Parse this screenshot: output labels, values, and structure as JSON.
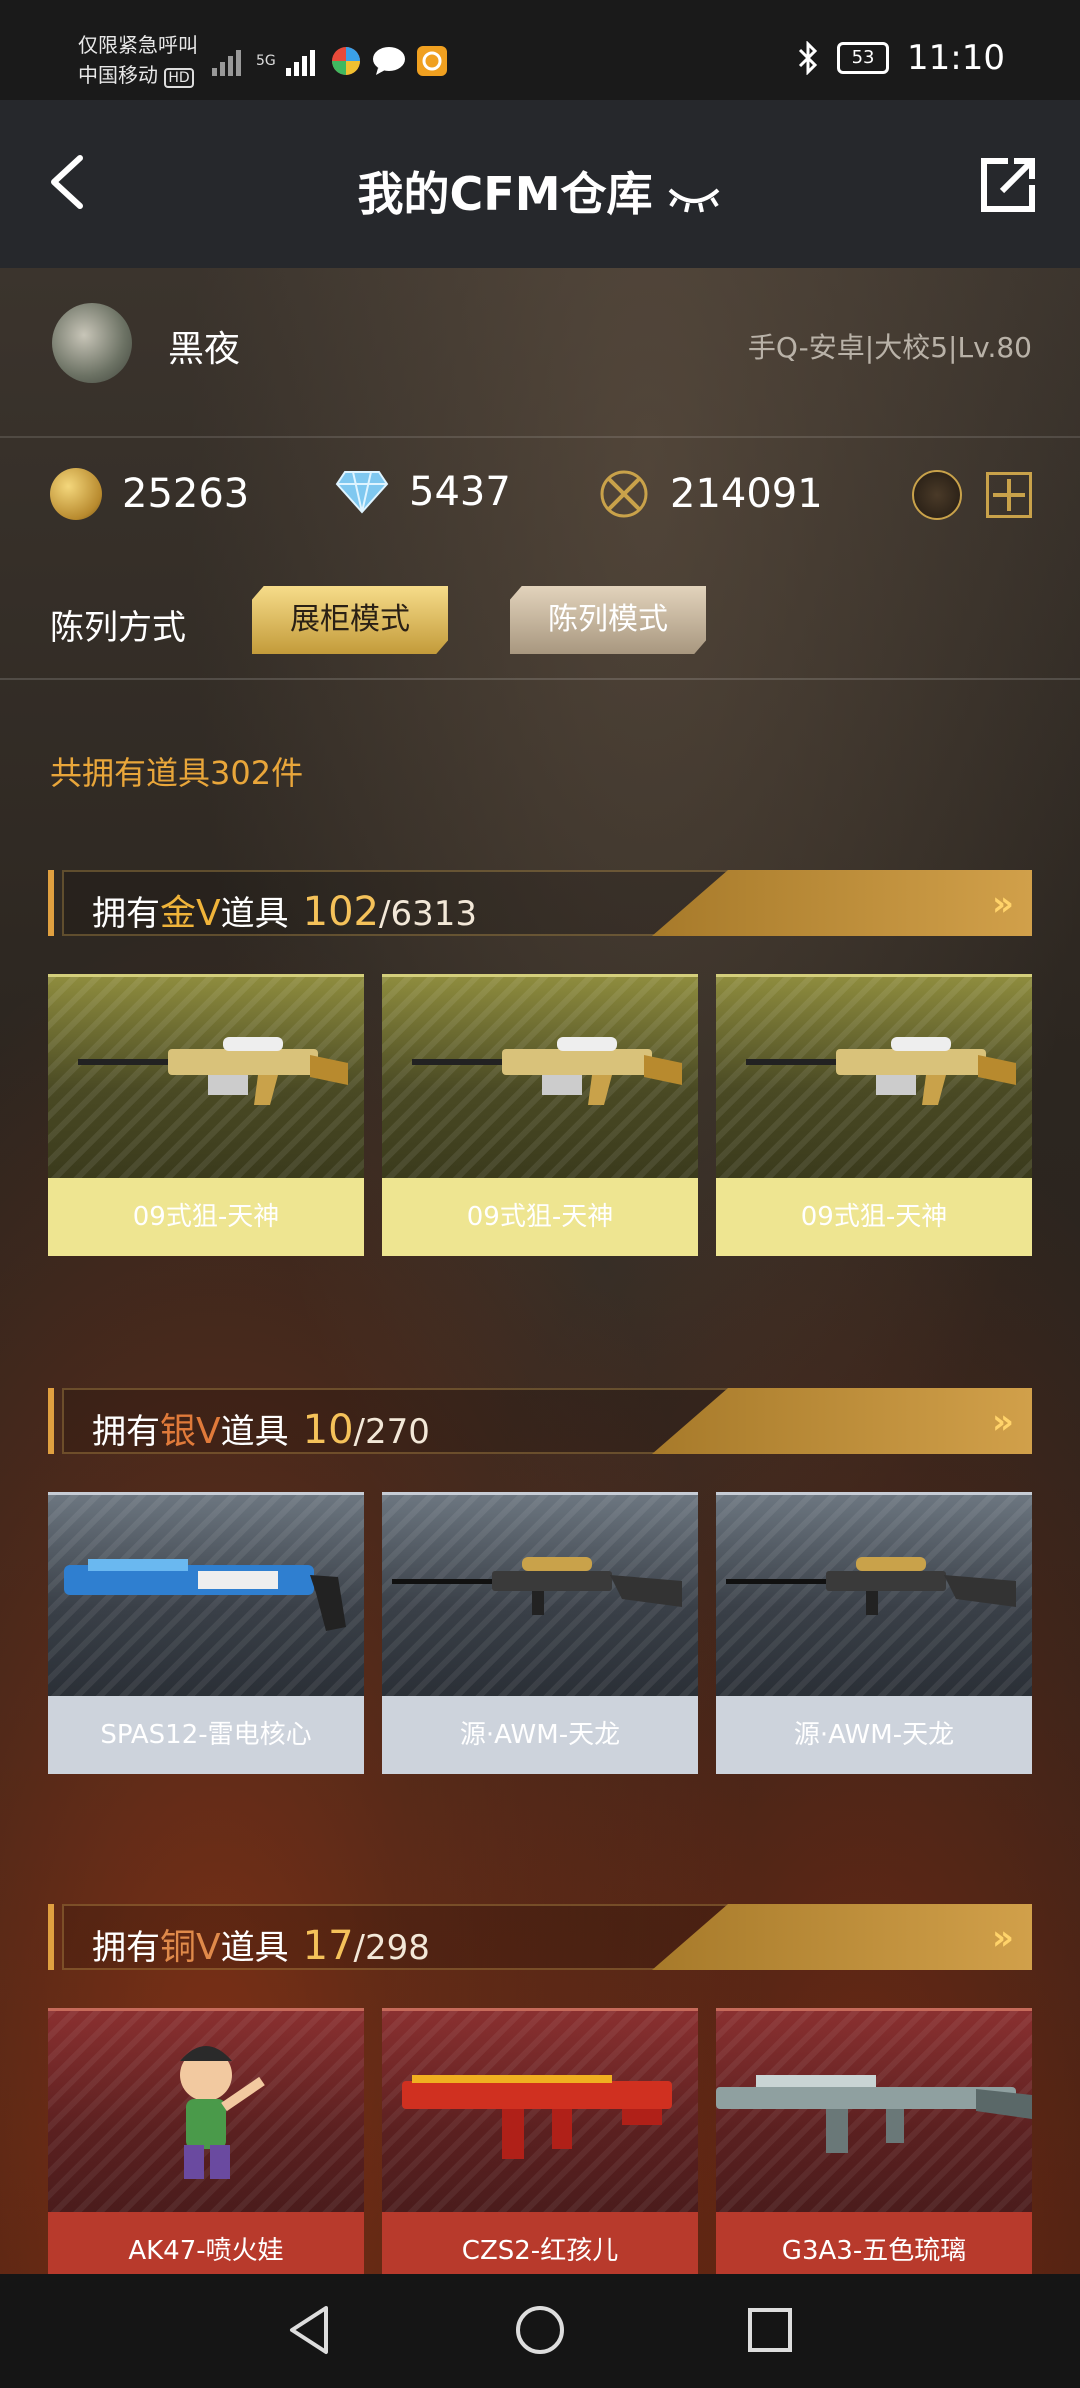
{
  "status_bar": {
    "line1": "仅限紧急呼叫",
    "line2": "中国移动",
    "hd": "HD",
    "network": "5G",
    "battery": "53",
    "time": "11:10"
  },
  "header": {
    "title": "我的CFM仓库"
  },
  "user": {
    "name": "黑夜",
    "info": "手Q-安卓|大校5|Lv.80"
  },
  "currency": {
    "gold": "25263",
    "diamond": "5437",
    "honor": "214091"
  },
  "display_mode": {
    "label": "陈列方式",
    "cabinet": "展柜模式",
    "list": "陈列模式"
  },
  "total_items": "共拥有道具302件",
  "sections": [
    {
      "prefix": "拥有",
      "tier": "金V",
      "suffix": "道具",
      "count": "102",
      "total": "/6313",
      "items": [
        "09式狙-天神",
        "09式狙-天神",
        "09式狙-天神"
      ]
    },
    {
      "prefix": "拥有",
      "tier": "银V",
      "suffix": "道具",
      "count": "10",
      "total": "/270",
      "items": [
        "SPAS12-雷电核心",
        "源·AWM-天龙",
        "源·AWM-天龙"
      ]
    },
    {
      "prefix": "拥有",
      "tier": "铜V",
      "suffix": "道具",
      "count": "17",
      "total": "/298",
      "items": [
        "AK47-喷火娃",
        "CZS2-红孩儿",
        "G3A3-五色琉璃"
      ]
    }
  ],
  "colors": {
    "gold_tier": "#f0b43a",
    "silver_tier": "#d8dde6",
    "copper_tier": "#e08a4a"
  }
}
